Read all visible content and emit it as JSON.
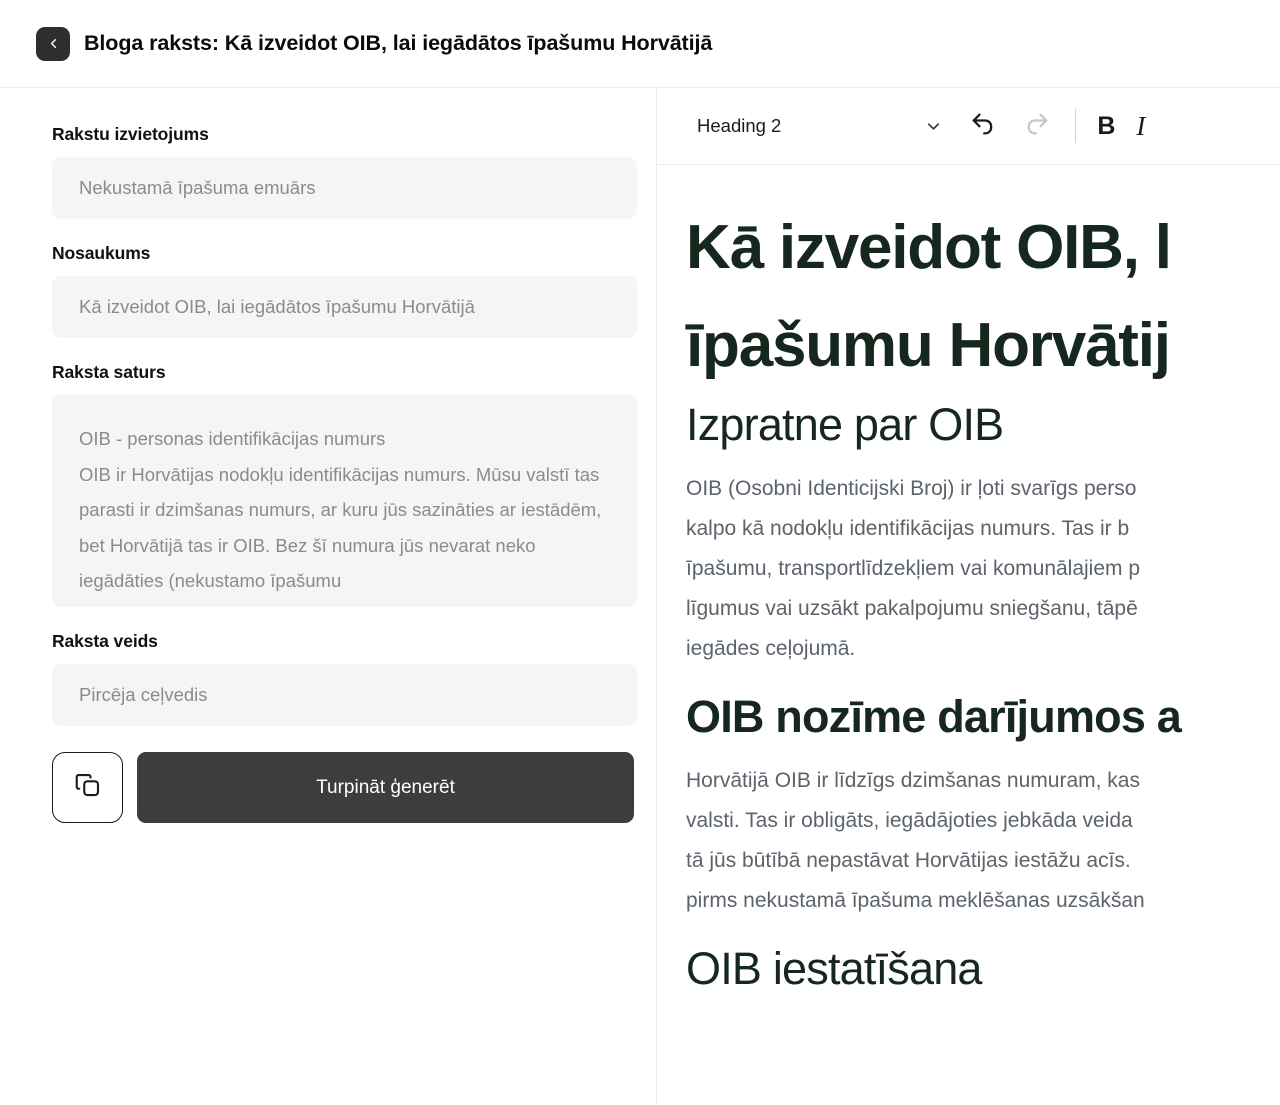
{
  "header": {
    "back_icon": "chevron-left-icon",
    "title": "Bloga raksts: Kā izveidot OIB, lai iegādātos īpašumu Horvātijā"
  },
  "form": {
    "placement": {
      "label": "Rakstu izvietojums",
      "placeholder": "Nekustamā īpašuma emuārs",
      "value": ""
    },
    "title": {
      "label": "Nosaukums",
      "placeholder": "Kā izveidot OIB, lai iegādātos īpašumu Horvātijā",
      "value": ""
    },
    "content": {
      "label": "Raksta saturs",
      "placeholder": "OIB - personas identifikācijas numurs\nOIB ir Horvātijas nodokļu identifikācijas numurs. Mūsu valstī tas parasti ir dzimšanas numurs, ar kuru jūs sazināties ar iestādēm, bet Horvātijā tas ir OIB. Bez šī numura jūs nevarat neko iegādāties (nekustamo īpašumu",
      "value": ""
    },
    "type": {
      "label": "Raksta veids",
      "placeholder": "Pircēja ceļvedis",
      "value": ""
    },
    "copy_icon": "copy-icon",
    "generate_label": "Turpināt ģenerēt"
  },
  "editor": {
    "toolbar": {
      "block_format": "Heading 2",
      "chevron_icon": "chevron-down-icon",
      "undo_icon": "undo-icon",
      "redo_icon": "redo-icon",
      "bold_label": "B",
      "italic_label": "I"
    },
    "document": {
      "h1_line1": "Kā izveidot OIB, l",
      "h1_line2": "īpašumu Horvātij",
      "h2_a": "Izpratne par OIB",
      "p_a_lines": [
        "OIB (Osobni Identicijski Broj) ir ļoti svarīgs perso",
        "kalpo kā nodokļu identifikācijas numurs. Tas ir b",
        "īpašumu, transportlīdzekļiem vai komunālajiem p",
        "līgumus vai uzsākt pakalpojumu sniegšanu, tāpē",
        "iegādes ceļojumā."
      ],
      "h2_b": "OIB nozīme darījumos a",
      "p_b_lines": [
        "Horvātijā OIB ir līdzīgs dzimšanas numuram, kas",
        "valsti. Tas ir obligāts, iegādājoties jebkāda veida",
        "tā jūs būtībā nepastāvat Horvātijas iestāžu acīs.",
        "pirms nekustamā īpašuma meklēšanas uzsākšan"
      ],
      "h2_c": "OIB iestatīšana"
    }
  },
  "colors": {
    "heading_green": "#16281e",
    "body_gray": "#5c636b",
    "button_dark": "#3d3d3d",
    "field_bg": "#f5f5f5",
    "placeholder_gray": "#8b8b8b"
  }
}
